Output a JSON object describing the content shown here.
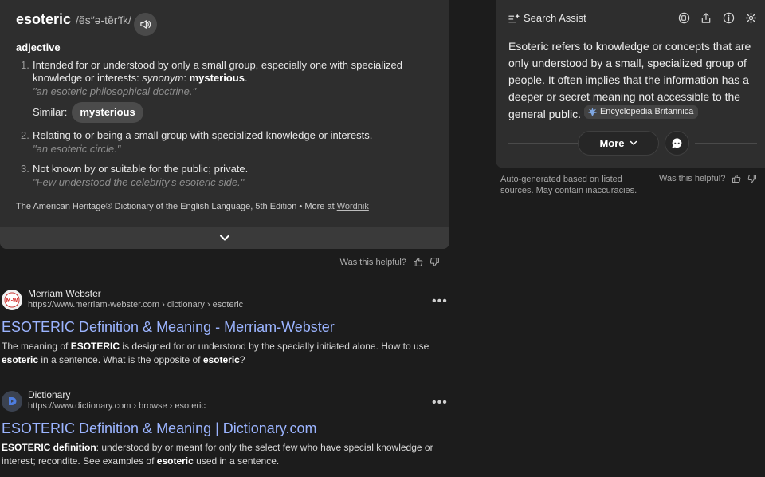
{
  "dictionary": {
    "word": "esoteric",
    "pronunciation": "/ĕs″ə-tĕr′ĭk/",
    "part_of_speech": "adjective",
    "definitions": [
      {
        "num": "1.",
        "text_before": "Intended for or understood by only a small group, especially one with specialized knowledge or interests: ",
        "synonym_label": "synonym",
        "synonym_sep": ": ",
        "synonym": "mysterious",
        "end": ".",
        "example": "\"an esoteric philosophical doctrine.\"",
        "similar_label": "Similar:",
        "similar_chip": "mysterious"
      },
      {
        "num": "2.",
        "text": "Relating to or being a small group with specialized knowledge or interests.",
        "example": "\"an esoteric circle.\""
      },
      {
        "num": "3.",
        "text": "Not known by or suitable for the public; private.",
        "example": "\"Few understood the celebrity's esoteric side.\""
      }
    ],
    "source_text": "The American Heritage® Dictionary of the English Language, 5th Edition •  More at ",
    "source_link": "Wordnik"
  },
  "helpful": {
    "label": "Was this helpful?"
  },
  "results": [
    {
      "site": "Merriam Webster",
      "url": "https://www.merriam-webster.com › dictionary › esoteric",
      "favicon_text": "M-W",
      "title": "ESOTERIC Definition & Meaning - Merriam-Webster",
      "snippet": [
        {
          "t": "The meaning of ",
          "b": false
        },
        {
          "t": "ESOTERIC",
          "b": true
        },
        {
          "t": " is designed for or understood by the specially initiated alone. How to use ",
          "b": false
        },
        {
          "t": "esoteric",
          "b": true
        },
        {
          "t": " in a sentence. What is the opposite of ",
          "b": false
        },
        {
          "t": "esoteric",
          "b": true
        },
        {
          "t": "?",
          "b": false
        }
      ],
      "more": "•••"
    },
    {
      "site": "Dictionary",
      "url": "https://www.dictionary.com › browse › esoteric",
      "title": "ESOTERIC Definition & Meaning | Dictionary.com",
      "snippet": [
        {
          "t": "ESOTERIC definition",
          "b": true
        },
        {
          "t": ": understood by or meant for only the select few who have special knowledge or interest; recondite. See examples of ",
          "b": false
        },
        {
          "t": "esoteric",
          "b": true
        },
        {
          "t": " used in a sentence.",
          "b": false
        }
      ],
      "more": "•••"
    }
  ],
  "assist": {
    "title": "Search Assist",
    "answer": "Esoteric refers to knowledge or concepts that are only understood by a small, specialized group of people. It often implies that the information has a deeper or secret meaning not accessible to the general public.",
    "citation": "Encyclopedia Britannica",
    "more_label": "More",
    "note": "Auto-generated based on listed sources. May contain inaccuracies.",
    "helpful_label": "Was this helpful?"
  },
  "colors": {
    "background": "#1c1c1c",
    "card": "#2e2e2e",
    "link_title": "#9bb4ff",
    "muted_text": "#8e8e8e"
  },
  "icons": [
    "speaker-icon",
    "chevron-down-icon",
    "thumbs-up-icon",
    "thumbs-down-icon",
    "sparkle-icon",
    "copy-icon",
    "share-icon",
    "info-icon",
    "gear-icon",
    "chat-icon",
    "britannica-logo-icon"
  ]
}
